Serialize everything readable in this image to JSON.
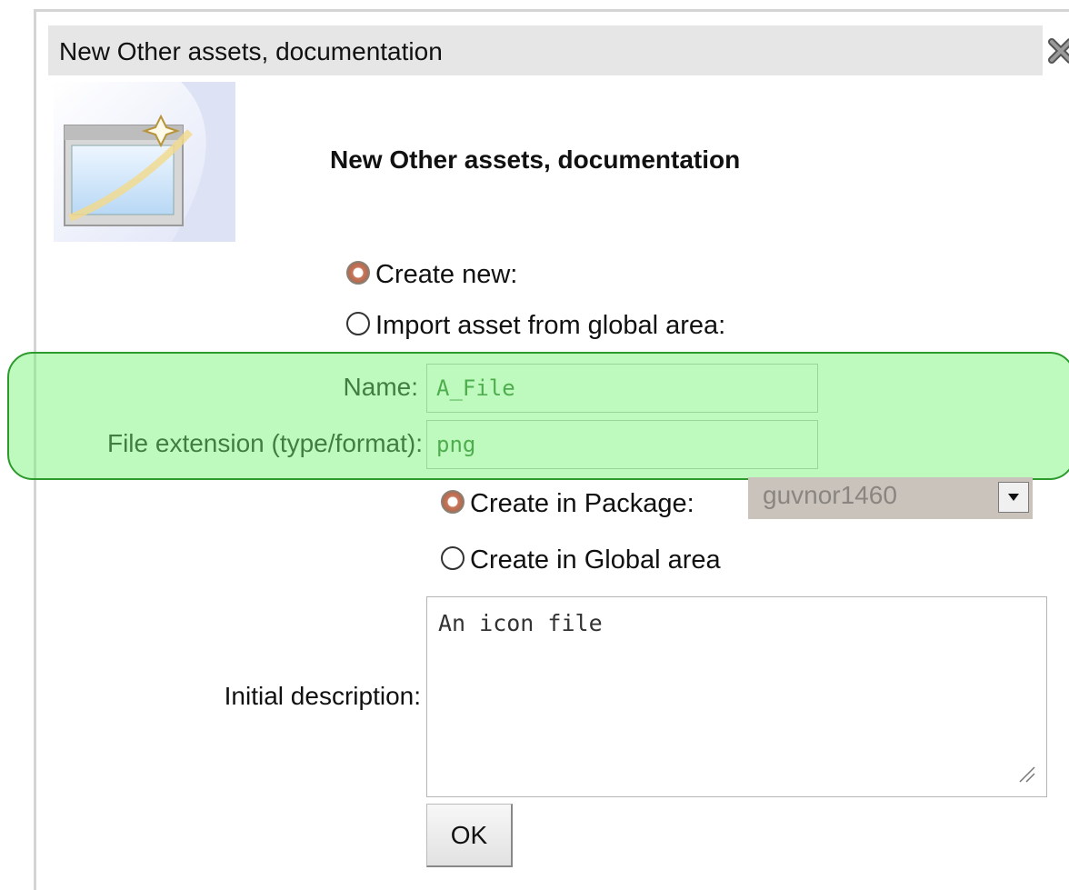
{
  "dialog": {
    "title": "New Other assets, documentation",
    "heading": "New Other assets, documentation",
    "close_icon": "close-x-icon",
    "image_icon": "new-window-wizard-icon"
  },
  "source_options": [
    {
      "label": "Create new:",
      "checked": true
    },
    {
      "label": "Import asset from global area:",
      "checked": false
    }
  ],
  "fields": {
    "name_label": "Name:",
    "name_value": "A_File",
    "extension_label": "File extension (type/format):",
    "extension_value": "png"
  },
  "location_options": {
    "package_label": "Create in Package:",
    "package_checked": true,
    "package_value": "guvnor1460",
    "global_label": "Create in Global area",
    "global_checked": false
  },
  "description": {
    "label": "Initial description:",
    "value": "An icon file"
  },
  "ok_label": "OK",
  "colors": {
    "highlight": "#78f578",
    "highlight_border": "#2c9b2c",
    "titlebar": "#e6e6e6"
  }
}
